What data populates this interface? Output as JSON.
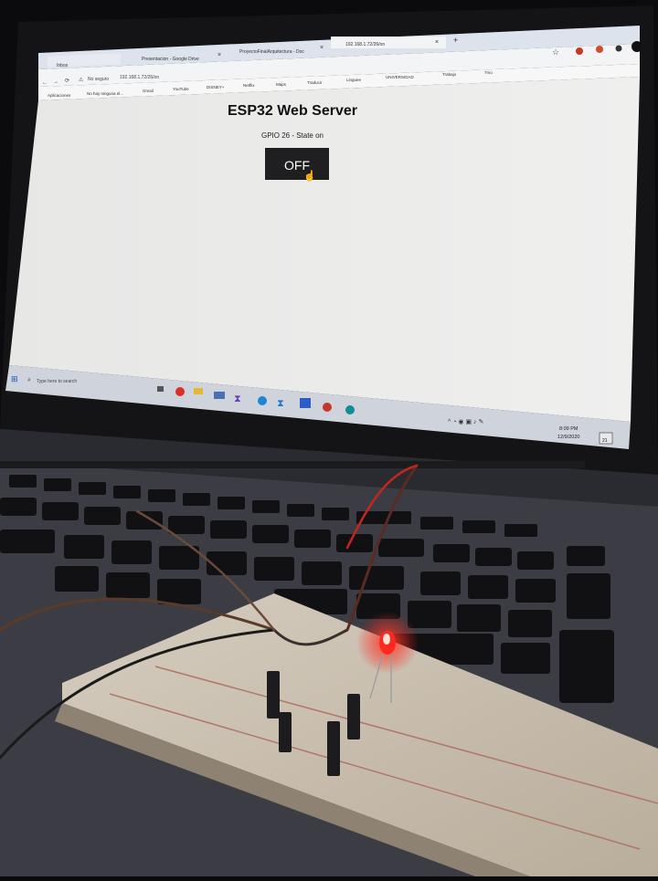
{
  "browser": {
    "tabs": [
      {
        "label": "Inbox"
      },
      {
        "label": "Presentacion - Google Drive"
      },
      {
        "label": "ProyectoFinalArquitectura - Doc"
      },
      {
        "label": "192.168.1.72/26/on"
      }
    ],
    "new_tab": "+",
    "security_label": "No seguro",
    "url": "192.168.1.72/26/on",
    "bookmarks": [
      {
        "label": "Aplicaciones"
      },
      {
        "label": "No hay ninguna el..."
      },
      {
        "label": "Gmail"
      },
      {
        "label": "YouTube"
      },
      {
        "label": "DISNEY+"
      },
      {
        "label": "Netflix"
      },
      {
        "label": "Maps"
      },
      {
        "label": "Traducir"
      },
      {
        "label": "Linguee"
      },
      {
        "label": "UNIVERSIDAD"
      },
      {
        "label": "Trabajo"
      },
      {
        "label": "7mo"
      }
    ]
  },
  "page": {
    "title": "ESP32 Web Server",
    "status": "GPIO 26 - State on",
    "button_label": "OFF"
  },
  "taskbar": {
    "search_placeholder": "Type here to search",
    "time": "8:09 PM",
    "date": "12/9/2020",
    "notification_count": "21"
  },
  "colors": {
    "page_bg": "#ececeb",
    "button_bg": "#1f1f21",
    "taskbar_bg": "#cfd3db",
    "led": "#ff2a1f"
  }
}
